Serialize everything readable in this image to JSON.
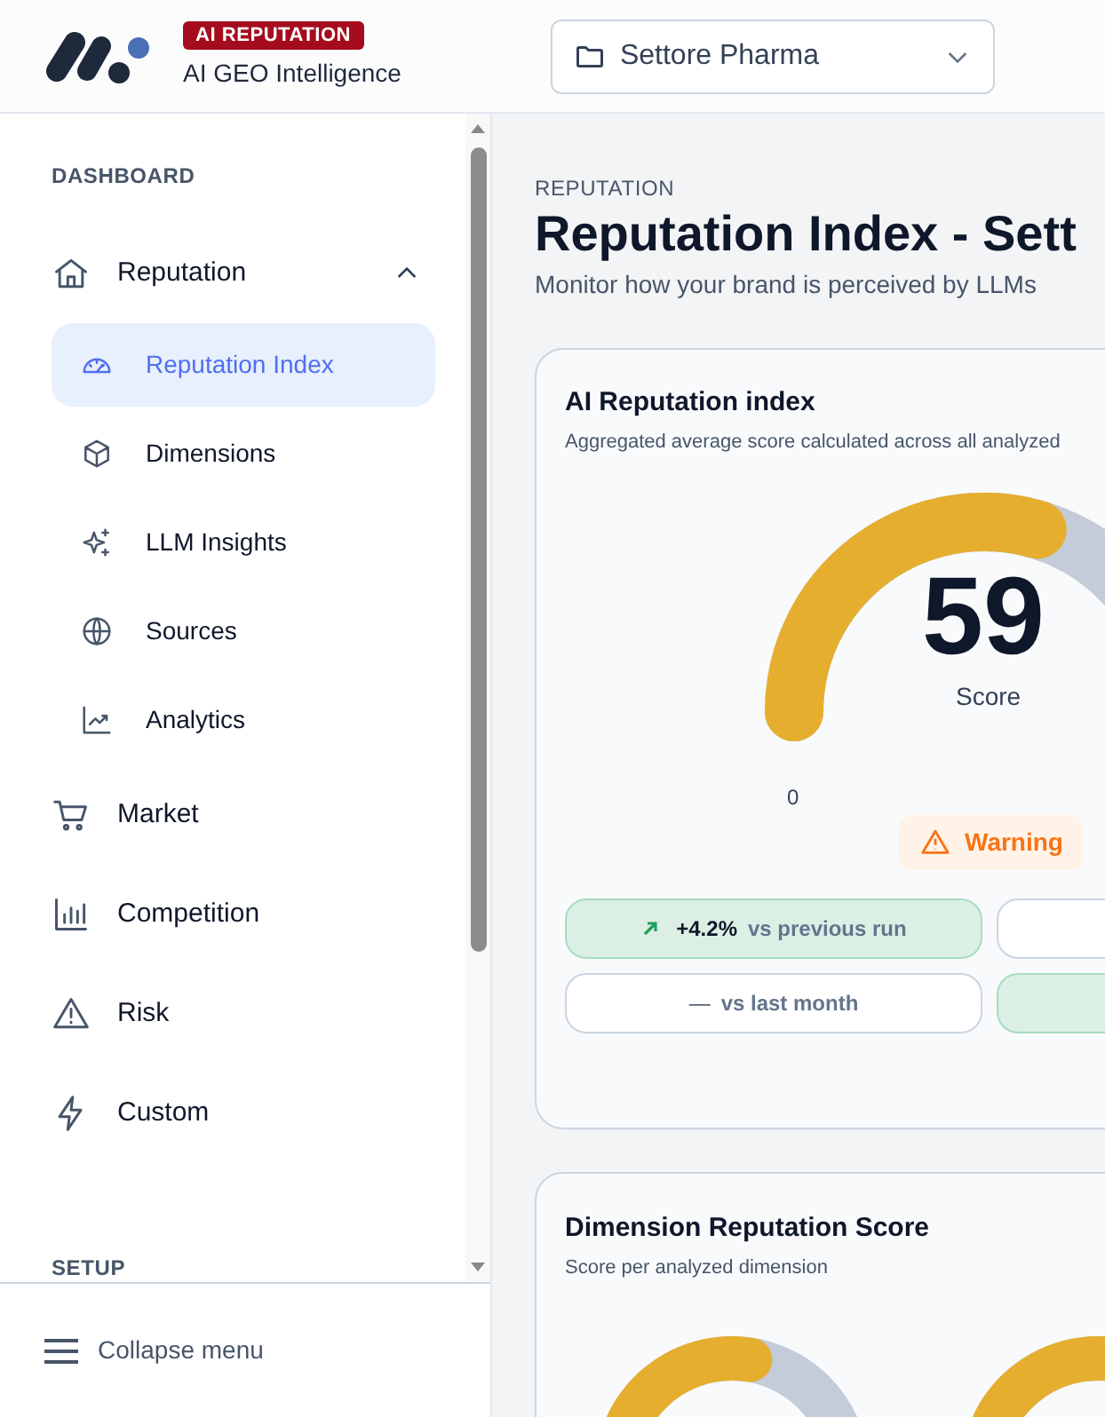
{
  "header": {
    "badge": "AI REPUTATION",
    "product": "AI GEO Intelligence",
    "project_select": {
      "value": "Settore Pharma"
    }
  },
  "sidebar": {
    "sections": [
      {
        "title": "DASHBOARD",
        "items": [
          {
            "label": "Reputation",
            "expanded": true,
            "children": [
              {
                "label": "Reputation Index",
                "selected": true
              },
              {
                "label": "Dimensions",
                "selected": false
              },
              {
                "label": "LLM Insights",
                "selected": false
              },
              {
                "label": "Sources",
                "selected": false
              },
              {
                "label": "Analytics",
                "selected": false
              }
            ]
          },
          {
            "label": "Market"
          },
          {
            "label": "Competition"
          },
          {
            "label": "Risk"
          },
          {
            "label": "Custom"
          }
        ]
      },
      {
        "title": "SETUP"
      }
    ],
    "collapse": "Collapse menu"
  },
  "page": {
    "eyebrow": "REPUTATION",
    "title": "Reputation Index - Sett",
    "subtitle": "Monitor how your brand is perceived by LLMs"
  },
  "index_card": {
    "title": "AI Reputation index",
    "subtitle": "Aggregated average score calculated across all analyzed",
    "gauge": {
      "level": 0.59,
      "value": "59",
      "caption": "Score",
      "min_label": "0"
    },
    "status": "Warning",
    "chips": [
      {
        "kind": "positive",
        "value": "+4.2%",
        "label": "vs previous run"
      },
      {
        "kind": "neutral"
      },
      {
        "kind": "neutral",
        "value": "—",
        "label": "vs last month"
      },
      {
        "kind": "positive"
      }
    ]
  },
  "dimension_card": {
    "title": "Dimension Reputation Score",
    "subtitle": "Score per analyzed dimension",
    "gauges": [
      {
        "level": 0.55
      },
      {
        "level": 0.55
      }
    ]
  }
}
